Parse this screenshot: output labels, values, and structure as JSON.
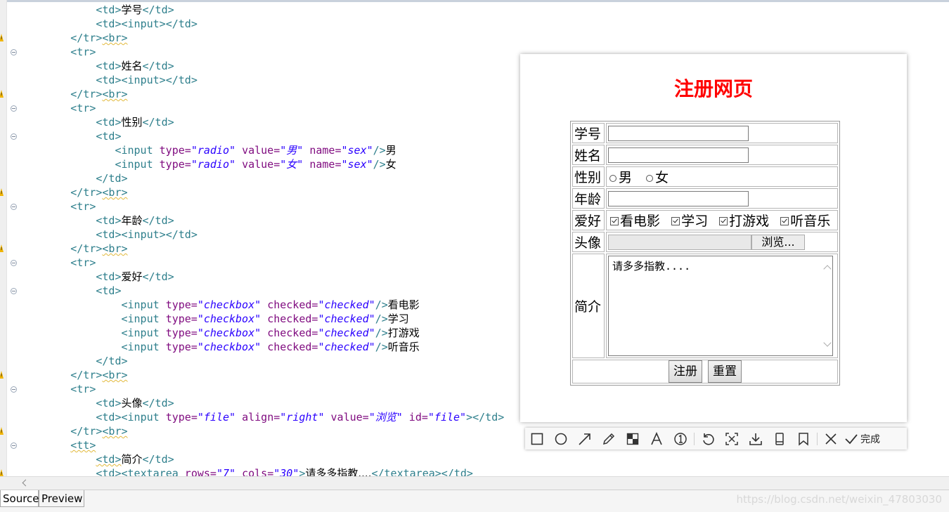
{
  "editor": {
    "lines": [
      {
        "indent": 12,
        "marker": "",
        "tokens": [
          [
            "tag",
            "<td>"
          ],
          [
            "txt",
            "学号"
          ],
          [
            "tag",
            "</td>"
          ]
        ]
      },
      {
        "indent": 12,
        "marker": "",
        "tokens": [
          [
            "tag",
            "<td><input></td>"
          ]
        ]
      },
      {
        "indent": 8,
        "marker": "warn",
        "tokens": [
          [
            "tag",
            "</tr>"
          ],
          [
            "tagsq",
            "<br>"
          ]
        ]
      },
      {
        "indent": 8,
        "marker": "fold",
        "tokens": [
          [
            "tag",
            "<tr>"
          ]
        ]
      },
      {
        "indent": 12,
        "marker": "",
        "tokens": [
          [
            "tag",
            "<td>"
          ],
          [
            "txt",
            "姓名"
          ],
          [
            "tag",
            "</td>"
          ]
        ]
      },
      {
        "indent": 12,
        "marker": "",
        "tokens": [
          [
            "tag",
            "<td><input></td>"
          ]
        ]
      },
      {
        "indent": 8,
        "marker": "warn",
        "tokens": [
          [
            "tag",
            "</tr>"
          ],
          [
            "tagsq",
            "<br>"
          ]
        ]
      },
      {
        "indent": 8,
        "marker": "fold",
        "tokens": [
          [
            "tag",
            "<tr>"
          ]
        ]
      },
      {
        "indent": 12,
        "marker": "",
        "tokens": [
          [
            "tag",
            "<td>"
          ],
          [
            "txt",
            "性别"
          ],
          [
            "tag",
            "</td>"
          ]
        ]
      },
      {
        "indent": 12,
        "marker": "fold",
        "tokens": [
          [
            "tag",
            "<td>"
          ]
        ]
      },
      {
        "indent": 15,
        "marker": "",
        "tokens": [
          [
            "tag",
            "<input "
          ],
          [
            "attr",
            "type="
          ],
          [
            "val",
            "\"radio\""
          ],
          [
            "tag",
            " "
          ],
          [
            "attr",
            "value="
          ],
          [
            "val",
            "\"男\""
          ],
          [
            "tag",
            " "
          ],
          [
            "attr",
            "name="
          ],
          [
            "val",
            "\"sex\""
          ],
          [
            "tag",
            "/>"
          ],
          [
            "txt",
            "男"
          ]
        ]
      },
      {
        "indent": 15,
        "marker": "",
        "tokens": [
          [
            "tag",
            "<input "
          ],
          [
            "attr",
            "type="
          ],
          [
            "val",
            "\"radio\""
          ],
          [
            "tag",
            " "
          ],
          [
            "attr",
            "value="
          ],
          [
            "val",
            "\"女\""
          ],
          [
            "tag",
            " "
          ],
          [
            "attr",
            "name="
          ],
          [
            "val",
            "\"sex\""
          ],
          [
            "tag",
            "/>"
          ],
          [
            "txt",
            "女"
          ]
        ]
      },
      {
        "indent": 12,
        "marker": "",
        "tokens": [
          [
            "tag",
            "</td>"
          ]
        ]
      },
      {
        "indent": 8,
        "marker": "warn",
        "tokens": [
          [
            "tag",
            "</tr>"
          ],
          [
            "tagsq",
            "<br>"
          ]
        ]
      },
      {
        "indent": 8,
        "marker": "fold",
        "tokens": [
          [
            "tag",
            "<tr>"
          ]
        ]
      },
      {
        "indent": 12,
        "marker": "",
        "tokens": [
          [
            "tag",
            "<td>"
          ],
          [
            "txt",
            "年龄"
          ],
          [
            "tag",
            "</td>"
          ]
        ]
      },
      {
        "indent": 12,
        "marker": "",
        "tokens": [
          [
            "tag",
            "<td><input></td>"
          ]
        ]
      },
      {
        "indent": 8,
        "marker": "warn",
        "tokens": [
          [
            "tag",
            "</tr>"
          ],
          [
            "tagsq",
            "<br>"
          ]
        ]
      },
      {
        "indent": 8,
        "marker": "fold",
        "tokens": [
          [
            "tag",
            "<tr>"
          ]
        ]
      },
      {
        "indent": 12,
        "marker": "",
        "tokens": [
          [
            "tag",
            "<td>"
          ],
          [
            "txt",
            "爱好"
          ],
          [
            "tag",
            "</td>"
          ]
        ]
      },
      {
        "indent": 12,
        "marker": "fold",
        "tokens": [
          [
            "tag",
            "<td>"
          ]
        ]
      },
      {
        "indent": 16,
        "marker": "",
        "tokens": [
          [
            "tag",
            "<input "
          ],
          [
            "attr",
            "type="
          ],
          [
            "val",
            "\"checkbox\""
          ],
          [
            "tag",
            " "
          ],
          [
            "attr",
            "checked="
          ],
          [
            "val",
            "\"checked\""
          ],
          [
            "tag",
            "/>"
          ],
          [
            "txt",
            "看电影"
          ]
        ]
      },
      {
        "indent": 16,
        "marker": "",
        "tokens": [
          [
            "tag",
            "<input "
          ],
          [
            "attr",
            "type="
          ],
          [
            "val",
            "\"checkbox\""
          ],
          [
            "tag",
            " "
          ],
          [
            "attr",
            "checked="
          ],
          [
            "val",
            "\"checked\""
          ],
          [
            "tag",
            "/>"
          ],
          [
            "txt",
            "学习"
          ]
        ]
      },
      {
        "indent": 16,
        "marker": "",
        "tokens": [
          [
            "tag",
            "<input "
          ],
          [
            "attr",
            "type="
          ],
          [
            "val",
            "\"checkbox\""
          ],
          [
            "tag",
            " "
          ],
          [
            "attr",
            "checked="
          ],
          [
            "val",
            "\"checked\""
          ],
          [
            "tag",
            "/>"
          ],
          [
            "txt",
            "打游戏"
          ]
        ]
      },
      {
        "indent": 16,
        "marker": "",
        "tokens": [
          [
            "tag",
            "<input "
          ],
          [
            "attr",
            "type="
          ],
          [
            "val",
            "\"checkbox\""
          ],
          [
            "tag",
            " "
          ],
          [
            "attr",
            "checked="
          ],
          [
            "val",
            "\"checked\""
          ],
          [
            "tag",
            "/>"
          ],
          [
            "txt",
            "听音乐"
          ]
        ]
      },
      {
        "indent": 12,
        "marker": "",
        "tokens": [
          [
            "tag",
            "</td>"
          ]
        ]
      },
      {
        "indent": 8,
        "marker": "warn",
        "tokens": [
          [
            "tag",
            "</tr>"
          ],
          [
            "tagsq",
            "<br>"
          ]
        ]
      },
      {
        "indent": 8,
        "marker": "fold",
        "tokens": [
          [
            "tag",
            "<tr>"
          ]
        ]
      },
      {
        "indent": 12,
        "marker": "",
        "tokens": [
          [
            "tag",
            "<td>"
          ],
          [
            "txt",
            "头像"
          ],
          [
            "tag",
            "</td>"
          ]
        ]
      },
      {
        "indent": 12,
        "marker": "",
        "tokens": [
          [
            "tag",
            "<td><input "
          ],
          [
            "attr",
            "type="
          ],
          [
            "val",
            "\"file\""
          ],
          [
            "tag",
            " "
          ],
          [
            "attr",
            "align="
          ],
          [
            "val",
            "\"right\""
          ],
          [
            "tag",
            " "
          ],
          [
            "attr",
            "value="
          ],
          [
            "val",
            "\"浏览\""
          ],
          [
            "tag",
            " "
          ],
          [
            "attr",
            "id="
          ],
          [
            "val",
            "\"file\""
          ],
          [
            "tag",
            "></td>"
          ]
        ]
      },
      {
        "indent": 8,
        "marker": "warn",
        "tokens": [
          [
            "tag",
            "</tr>"
          ],
          [
            "tagsq",
            "<br>"
          ]
        ]
      },
      {
        "indent": 8,
        "marker": "fold",
        "tokens": [
          [
            "tagsq",
            "<tt>"
          ]
        ]
      },
      {
        "indent": 12,
        "marker": "",
        "tokens": [
          [
            "tagsq",
            "<td>"
          ],
          [
            "txt",
            "简介"
          ],
          [
            "tag",
            "</td>"
          ]
        ]
      },
      {
        "indent": 12,
        "marker": "warn",
        "tokens": [
          [
            "tag",
            "<td><textarea "
          ],
          [
            "attr",
            "rows="
          ],
          [
            "val",
            "\"7\""
          ],
          [
            "tag",
            " "
          ],
          [
            "attr",
            "cols="
          ],
          [
            "val",
            "\"30\""
          ],
          [
            "tag",
            ">"
          ],
          [
            "txt",
            "请多多指教...."
          ],
          [
            "tag",
            "</textarea></td>"
          ]
        ]
      }
    ]
  },
  "preview": {
    "title": "注册网页",
    "rows": {
      "student_id_label": "学号",
      "name_label": "姓名",
      "gender_label": "性别",
      "gender_options": [
        "男",
        "女"
      ],
      "age_label": "年龄",
      "hobby_label": "爱好",
      "hobbies": [
        "看电影",
        "学习",
        "打游戏",
        "听音乐"
      ],
      "avatar_label": "头像",
      "browse_button": "浏览...",
      "intro_label": "简介",
      "intro_value": "请多多指教...."
    },
    "submit_button": "注册",
    "reset_button": "重置"
  },
  "toolbar": {
    "tools": [
      "rectangle-icon",
      "circle-icon",
      "arrow-icon",
      "pencil-icon",
      "mosaic-icon",
      "text-icon",
      "number-icon",
      "undo-icon",
      "ocr-icon",
      "download-icon",
      "pin-icon",
      "bookmark-icon"
    ],
    "close_icon": "close-icon",
    "done_label": "完成"
  },
  "tabs": {
    "source": "Source",
    "preview": "Preview"
  },
  "watermark": "https://blog.csdn.net/weixin_47803030"
}
